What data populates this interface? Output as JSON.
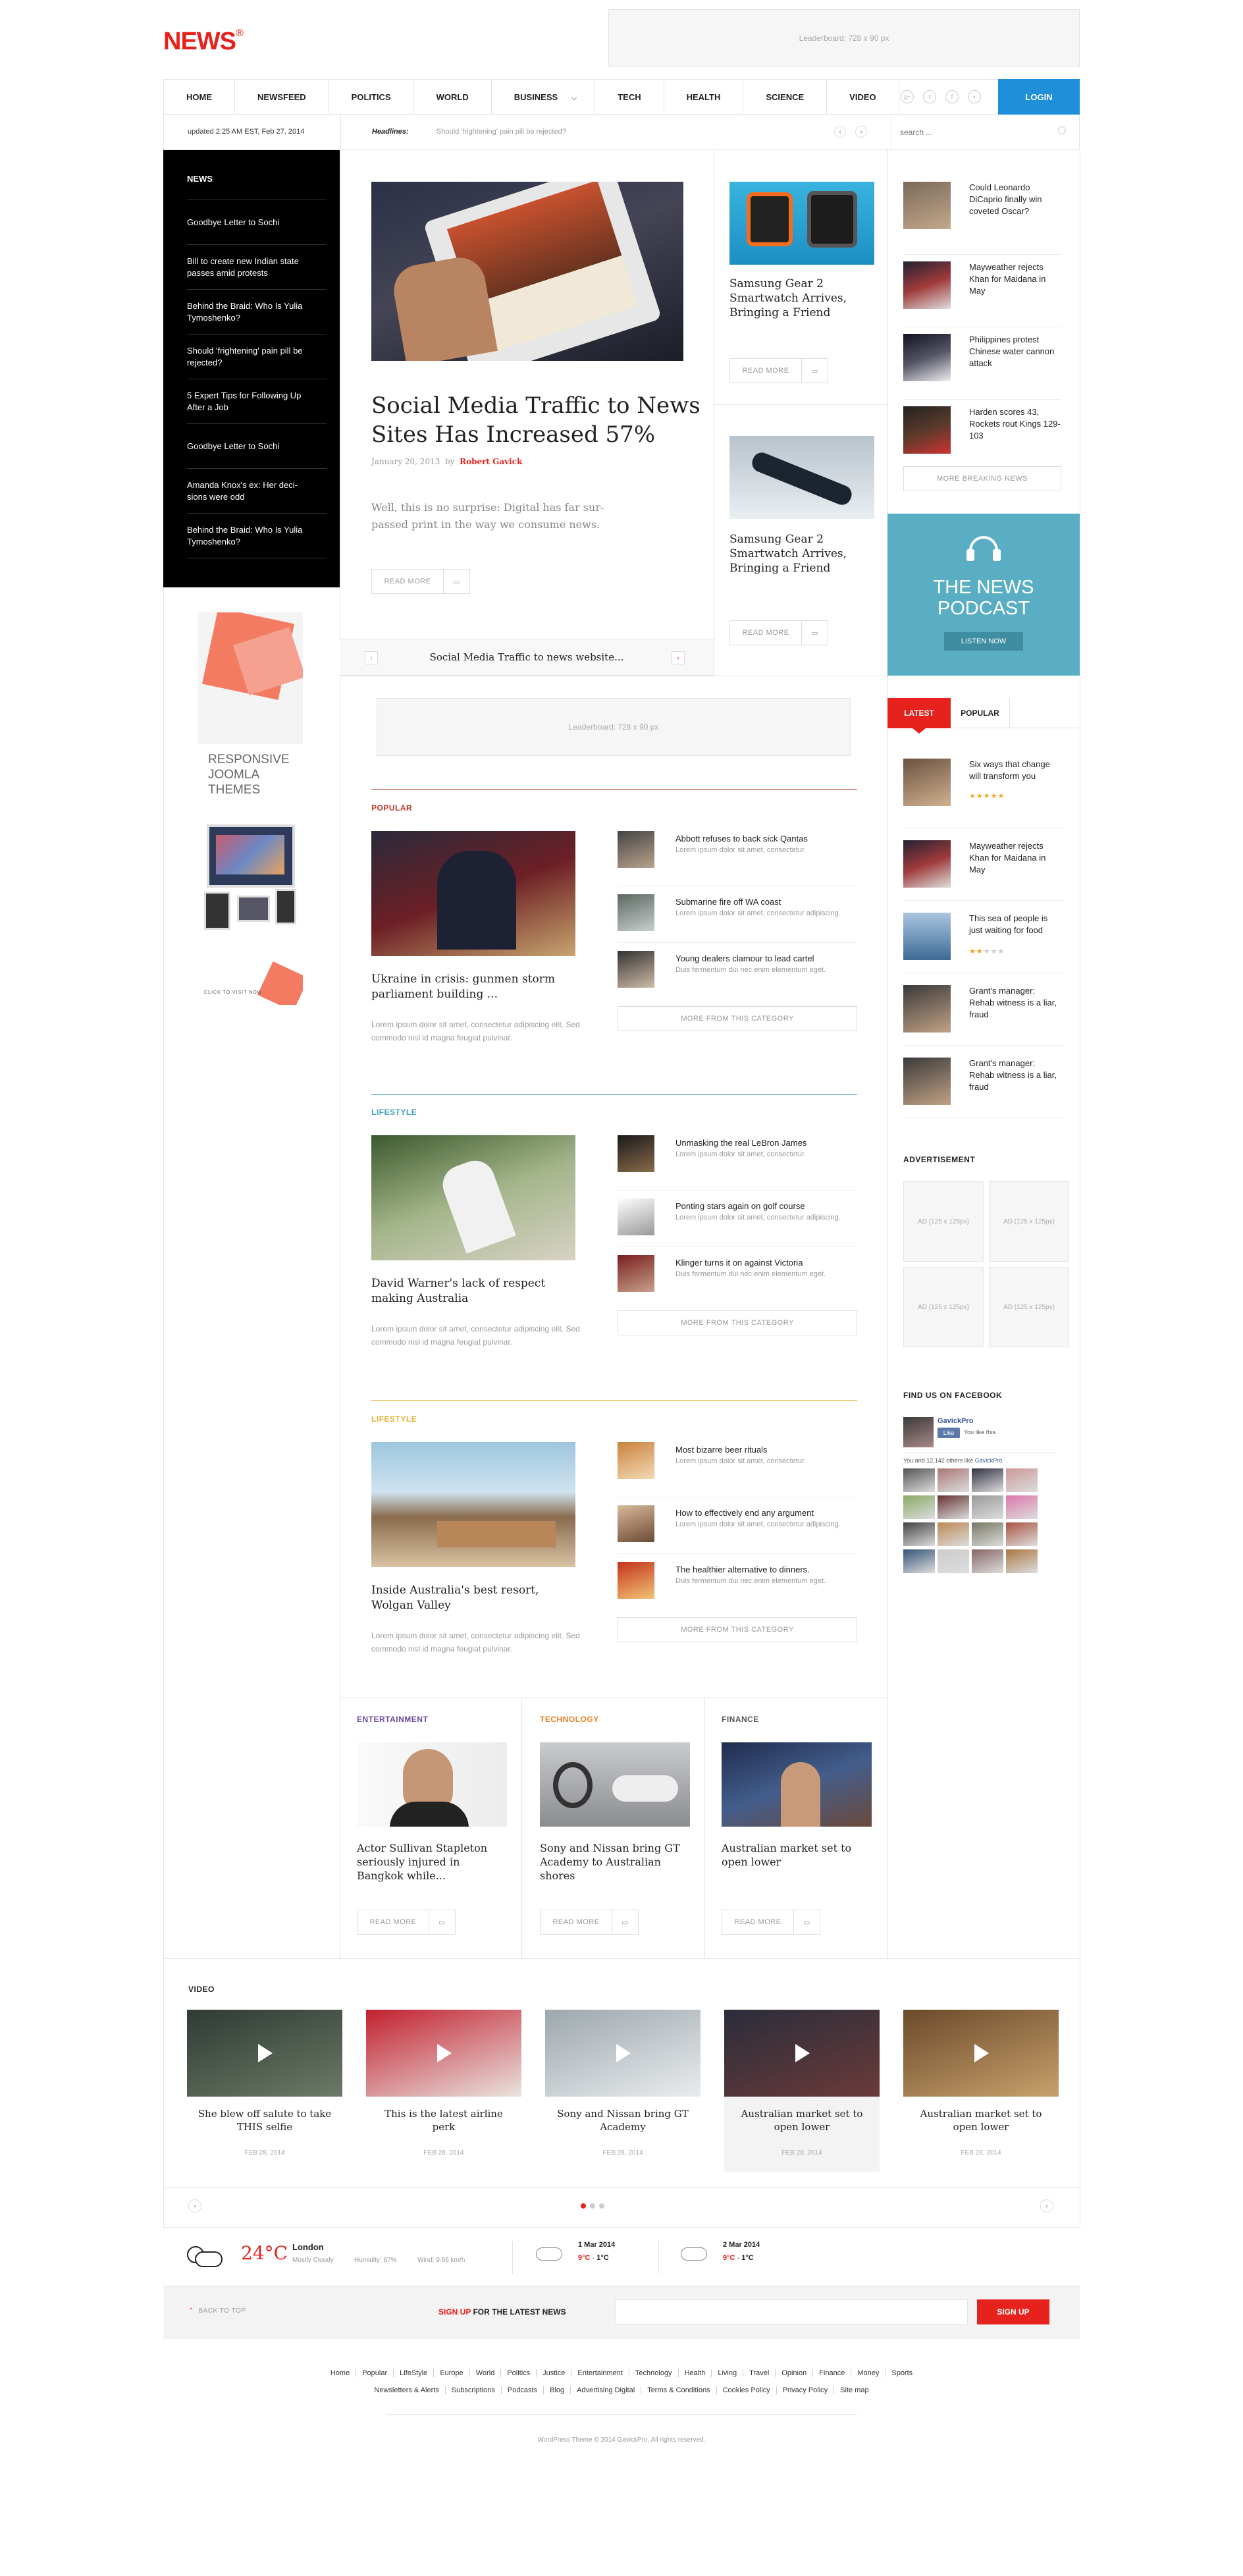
{
  "brand": {
    "logo": "NEWS",
    "logo_mark": "®"
  },
  "ads": {
    "leaderboard_top": "Leaderboard: 728 x 90 px",
    "leaderboard_mid": "Leaderboard: 728 x 90 px",
    "skyscraper_lines": [
      "RESPONSIVE",
      "JOOMLA",
      "THEMES"
    ],
    "skyscraper_foot": "CLICK TO VISIT NOW"
  },
  "nav": {
    "items": [
      "HOME",
      "NEWSFEED",
      "POLITICS",
      "WORLD",
      "BUSINESS",
      "TECH",
      "HEALTH",
      "SCIENCE",
      "VIDEO"
    ],
    "login": "LOGIN",
    "social": [
      "gplus-icon",
      "twitter-icon",
      "facebook-icon",
      "rss-icon"
    ]
  },
  "infobar": {
    "updated": "updated 2:25 AM EST, Feb 27, 2014",
    "headlines_label": "Headlines:",
    "headline": "Should 'frightening' pain pill be rejected?",
    "search_placeholder": "search ..."
  },
  "sidebar": {
    "title": "NEWS",
    "items": [
      "Goodbye Letter to Sochi",
      "Bill to create new Indian state passes amid protests",
      "Behind the Braid: Who Is Yulia Tymoshenko?",
      "Should 'frightening' pain pill be rejected?",
      "5 Expert Tips for Following Up After a Job",
      "Goodbye Letter to Sochi",
      "Amanda Knox's ex: Her deci-sions were odd",
      "Behind the Braid: Who Is Yulia Tymoshenko?"
    ]
  },
  "main_story": {
    "title": "Social Media Traffic to News Sites Has Increased 57%",
    "date": "January 20, 2013",
    "by": "by",
    "author": "Robert Gavick",
    "excerpt": "Well, this is no surprise: Digital has far sur-passed print in the way we consume news.",
    "read_more": "READ MORE",
    "slider_caption": "Social Media Traffic to news website..."
  },
  "mid_stories": [
    {
      "title": "Samsung Gear 2 Smartwatch Arrives, Bringing a Friend",
      "read_more": "READ MORE"
    },
    {
      "title": "Samsung Gear 2 Smartwatch Arrives, Bringing a Friend",
      "read_more": "READ MORE"
    }
  ],
  "breaking": {
    "items": [
      "Could Leonardo DiCaprio finally win coveted Oscar?",
      "Mayweather rejects Khan for Maidana in May",
      "Philippines protest Chinese water cannon attack",
      "Harden scores 43, Rockets rout Kings 129-103"
    ],
    "more": "MORE BREAKING NEWS"
  },
  "podcast": {
    "line1": "THE NEWS",
    "line2": "PODCAST",
    "button": "LISTEN NOW"
  },
  "categories": [
    {
      "label": "POPULAR",
      "color": "#c0392b",
      "title": "Ukraine in crisis: gunmen storm parliament building ...",
      "excerpt": "Lorem ipsum dolor sit amet, consectetur adipiscing elit. Sed commodo nisl id magna feugiat pulvinar.",
      "items": [
        {
          "t": "Abbott refuses to back sick Qantas",
          "d": "Lorem ipsum dolor sit amet, consectetur."
        },
        {
          "t": "Submarine fire off WA coast",
          "d": "Lorem ipsum dolor sit amet, consectetur adipiscing."
        },
        {
          "t": "Young dealers clamour to lead cartel",
          "d": "Duis fermentum dui nec enim elementum eget."
        }
      ],
      "more": "MORE FROM THIS CATEGORY"
    },
    {
      "label": "LIFESTYLE",
      "color": "#45a1bd",
      "title": "David Warner's lack of respect making Australia",
      "excerpt": "Lorem ipsum dolor sit amet, consectetur adipiscing elit. Sed commodo nisl id magna feugiat pulvinar.",
      "items": [
        {
          "t": "Unmasking the real LeBron James",
          "d": "Lorem ipsum dolor sit amet, consectetur."
        },
        {
          "t": "Ponting stars again on golf course",
          "d": "Lorem ipsum dolor sit amet, consectetur adipiscing."
        },
        {
          "t": "Klinger turns it on against Victoria",
          "d": "Duis fermentum dui nec enim elementum eget."
        }
      ],
      "more": "MORE FROM THIS CATEGORY"
    },
    {
      "label": "LIFESTYLE",
      "color": "#e2b33a",
      "title": "Inside Australia's best resort, Wolgan Valley",
      "excerpt": "Lorem ipsum dolor sit amet, consectetur adipiscing elit. Sed commodo nisl id magna feugiat pulvinar.",
      "items": [
        {
          "t": "Most bizarre beer rituals",
          "d": "Lorem ipsum dolor sit amet, consectetur."
        },
        {
          "t": "How to effectively end any argument",
          "d": "Lorem ipsum dolor sit amet, consectetur adipiscing."
        },
        {
          "t": "The healthier alternative to dinners.",
          "d": "Duis fermentum dui nec enim elementum eget."
        }
      ],
      "more": "MORE FROM THIS CATEGORY"
    }
  ],
  "bottom_cats": [
    {
      "label": "ENTERTAINMENT",
      "color": "#6a4a9c",
      "title": "Actor Sullivan Stapleton seriously injured in Bangkok while...",
      "read_more": "READ MORE"
    },
    {
      "label": "TECHNOLOGY",
      "color": "#e67e22",
      "title": "Sony and Nissan bring GT Academy to Australian shores",
      "read_more": "READ MORE"
    },
    {
      "label": "FINANCE",
      "color": "#555555",
      "title": "Australian market set to open lower",
      "read_more": "READ MORE"
    }
  ],
  "tabs": {
    "latest": "LATEST",
    "popular": "POPULAR",
    "items": [
      {
        "t": "Six ways that change will transform you",
        "stars": 5
      },
      {
        "t": "Mayweather rejects Khan for Maidana in May",
        "stars": 0
      },
      {
        "t": "This sea of people is just waiting for food",
        "stars": 2
      },
      {
        "t": "Grant's manager: Rehab witness is a liar, fraud",
        "stars": 0
      },
      {
        "t": "Grant's manager: Rehab witness is a liar, fraud",
        "stars": 0
      }
    ]
  },
  "advert": {
    "title": "ADVERTISEMENT",
    "slots": [
      "AD (125 x 125px)",
      "AD (125 x 125px)",
      "AD (125 x 125px)",
      "AD (125 x 125px)"
    ]
  },
  "facebook": {
    "title": "FIND US ON FACEBOOK",
    "page": "GavickPro",
    "like": "Like",
    "you_like": "You like this.",
    "count_text": "You and 12,142 others like",
    "count_link": "GavickPro."
  },
  "video": {
    "title": "VIDEO",
    "items": [
      {
        "t": "She blew off salute to take THIS selfie",
        "d": "FEB 28, 2014"
      },
      {
        "t": "This is the latest airline perk",
        "d": "FEB 28, 2014"
      },
      {
        "t": "Sony and Nissan bring GT Academy",
        "d": "FEB 28, 2014"
      },
      {
        "t": "Australian market set to open lower",
        "d": "FEB 28, 2014"
      },
      {
        "t": "Australian market set to open lower",
        "d": "FEB 28, 2014"
      }
    ]
  },
  "weather": {
    "temp": "24°C",
    "city": "London",
    "cond": "Mostly Cloudy",
    "humidity": "Humidity: 87%",
    "wind": "Wind: 9.66 km/h",
    "days": [
      {
        "date": "1 Mar 2014",
        "hi": "9°C",
        "lo": "1°C"
      },
      {
        "date": "2 Mar 2014",
        "hi": "9°C",
        "lo": "1°C"
      }
    ],
    "sep": "-"
  },
  "signup": {
    "back_to_top": "BACK TO TOP",
    "sign": "SIGN UP",
    "rest": " FOR THE LATEST NEWS",
    "button": "SIGN UP"
  },
  "footer": {
    "row1": [
      "Home",
      "Popular",
      "LifeStyle",
      "Europe",
      "World",
      "Politics",
      "Justice",
      "Entertainment",
      "Technology",
      "Health",
      "Living",
      "Travel",
      "Opinion",
      "Finance",
      "Money",
      "Sports"
    ],
    "row2": [
      "Newsletters & Alerts",
      "Subscriptions",
      "Podcasts",
      "Blog",
      "Advertising Digital",
      "Terms & Conditions",
      "Cookies Policy",
      "Privacy Policy",
      "Site map"
    ],
    "copy": "WordPress Theme © 2014 GavickPro. All rights reserved."
  },
  "colors": {
    "accent": "#e7211b",
    "login": "#1e8fd8",
    "podcast": "#5aaec3",
    "sidebar": "#000000"
  }
}
